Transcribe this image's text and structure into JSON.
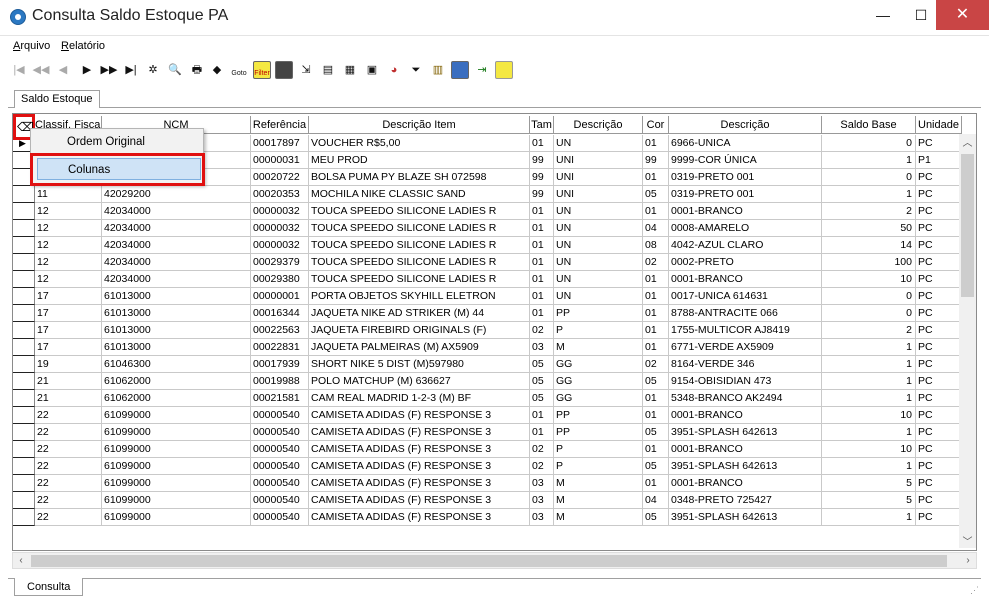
{
  "window": {
    "title": "Consulta Saldo Estoque PA",
    "min_label": "—",
    "max_label": "☐",
    "close_label": "✕"
  },
  "menu": {
    "arquivo_first": "A",
    "arquivo_rest": "rquivo",
    "relatorio_first": "R",
    "relatorio_rest": "elatório"
  },
  "toolbar": {
    "nav_first": "|◀",
    "nav_prev_page": "◀◀",
    "nav_prev": "◀",
    "nav_next": "▶",
    "nav_next_page": "▶▶",
    "nav_last": "▶|",
    "filter_label": "Filter",
    "goto_label": "Goto"
  },
  "tabs": {
    "top": "Saldo Estoque",
    "bottom": "Consulta"
  },
  "grid": {
    "columns": [
      "",
      "Classif. Fiscal",
      "NCM",
      "Referência",
      "Descrição Item",
      "Tam",
      "Descrição",
      "Cor",
      "Descrição",
      "Saldo Base",
      "Unidade"
    ],
    "rows": [
      [
        "",
        "",
        "00017897",
        "VOUCHER R$5,00",
        "01",
        "UN",
        "01",
        "6966-UNICA",
        "0",
        "PC"
      ],
      [
        "",
        "",
        "00000031",
        "MEU PROD",
        "99",
        "UNI",
        "99",
        "9999-COR ÚNICA",
        "1",
        "P1"
      ],
      [
        "",
        "",
        "00020722",
        "BOLSA PUMA PY BLAZE SH 072598",
        "99",
        "UNI",
        "01",
        "0319-PRETO 001",
        "0",
        "PC"
      ],
      [
        "11",
        "42029200",
        "00020353",
        "MOCHILA NIKE CLASSIC SAND",
        "99",
        "UNI",
        "05",
        "0319-PRETO 001",
        "1",
        "PC"
      ],
      [
        "12",
        "42034000",
        "00000032",
        "TOUCA SPEEDO SILICONE LADIES R",
        "01",
        "UN",
        "01",
        "0001-BRANCO",
        "2",
        "PC"
      ],
      [
        "12",
        "42034000",
        "00000032",
        "TOUCA SPEEDO SILICONE LADIES R",
        "01",
        "UN",
        "04",
        "0008-AMARELO",
        "50",
        "PC"
      ],
      [
        "12",
        "42034000",
        "00000032",
        "TOUCA SPEEDO SILICONE LADIES R",
        "01",
        "UN",
        "08",
        "4042-AZUL CLARO",
        "14",
        "PC"
      ],
      [
        "12",
        "42034000",
        "00029379",
        "TOUCA SPEEDO SILICONE LADIES R",
        "01",
        "UN",
        "02",
        "0002-PRETO",
        "100",
        "PC"
      ],
      [
        "12",
        "42034000",
        "00029380",
        "TOUCA SPEEDO SILICONE LADIES R",
        "01",
        "UN",
        "01",
        "0001-BRANCO",
        "10",
        "PC"
      ],
      [
        "17",
        "61013000",
        "00000001",
        "PORTA OBJETOS SKYHILL ELETRON",
        "01",
        "UN",
        "01",
        "0017-UNICA 614631",
        "0",
        "PC"
      ],
      [
        "17",
        "61013000",
        "00016344",
        "JAQUETA NIKE AD STRIKER (M) 44",
        "01",
        "PP",
        "01",
        "8788-ANTRACITE 066",
        "0",
        "PC"
      ],
      [
        "17",
        "61013000",
        "00022563",
        "JAQUETA FIREBIRD ORIGINALS (F)",
        "02",
        "P",
        "01",
        "1755-MULTICOR AJ8419",
        "2",
        "PC"
      ],
      [
        "17",
        "61013000",
        "00022831",
        "JAQUETA PALMEIRAS (M) AX5909",
        "03",
        "M",
        "01",
        "6771-VERDE AX5909",
        "1",
        "PC"
      ],
      [
        "19",
        "61046300",
        "00017939",
        "SHORT NIKE 5 DIST (M)597980",
        "05",
        "GG",
        "02",
        "8164-VERDE 346",
        "1",
        "PC"
      ],
      [
        "21",
        "61062000",
        "00019988",
        "POLO MATCHUP (M) 636627",
        "05",
        "GG",
        "05",
        "9154-OBISIDIAN 473",
        "1",
        "PC"
      ],
      [
        "21",
        "61062000",
        "00021581",
        "CAM REAL MADRID 1-2-3 (M) BF",
        "05",
        "GG",
        "01",
        "5348-BRANCO AK2494",
        "1",
        "PC"
      ],
      [
        "22",
        "61099000",
        "00000540",
        "CAMISETA ADIDAS (F) RESPONSE 3",
        "01",
        "PP",
        "01",
        "0001-BRANCO",
        "10",
        "PC"
      ],
      [
        "22",
        "61099000",
        "00000540",
        "CAMISETA ADIDAS (F) RESPONSE 3",
        "01",
        "PP",
        "05",
        "3951-SPLASH 642613",
        "1",
        "PC"
      ],
      [
        "22",
        "61099000",
        "00000540",
        "CAMISETA ADIDAS (F) RESPONSE 3",
        "02",
        "P",
        "01",
        "0001-BRANCO",
        "10",
        "PC"
      ],
      [
        "22",
        "61099000",
        "00000540",
        "CAMISETA ADIDAS (F) RESPONSE 3",
        "02",
        "P",
        "05",
        "3951-SPLASH 642613",
        "1",
        "PC"
      ],
      [
        "22",
        "61099000",
        "00000540",
        "CAMISETA ADIDAS (F) RESPONSE 3",
        "03",
        "M",
        "01",
        "0001-BRANCO",
        "5",
        "PC"
      ],
      [
        "22",
        "61099000",
        "00000540",
        "CAMISETA ADIDAS (F) RESPONSE 3",
        "03",
        "M",
        "04",
        "0348-PRETO 725427",
        "5",
        "PC"
      ],
      [
        "22",
        "61099000",
        "00000540",
        "CAMISETA ADIDAS (F) RESPONSE 3",
        "03",
        "M",
        "05",
        "3951-SPLASH 642613",
        "1",
        "PC"
      ]
    ]
  },
  "popup_menu": {
    "items": [
      "Ordem Original",
      "Colunas"
    ],
    "selected_index": 1
  },
  "colors": {
    "highlight_frame": "#e01010",
    "selection": "#cfe3f6",
    "close_button": "#c94545"
  }
}
